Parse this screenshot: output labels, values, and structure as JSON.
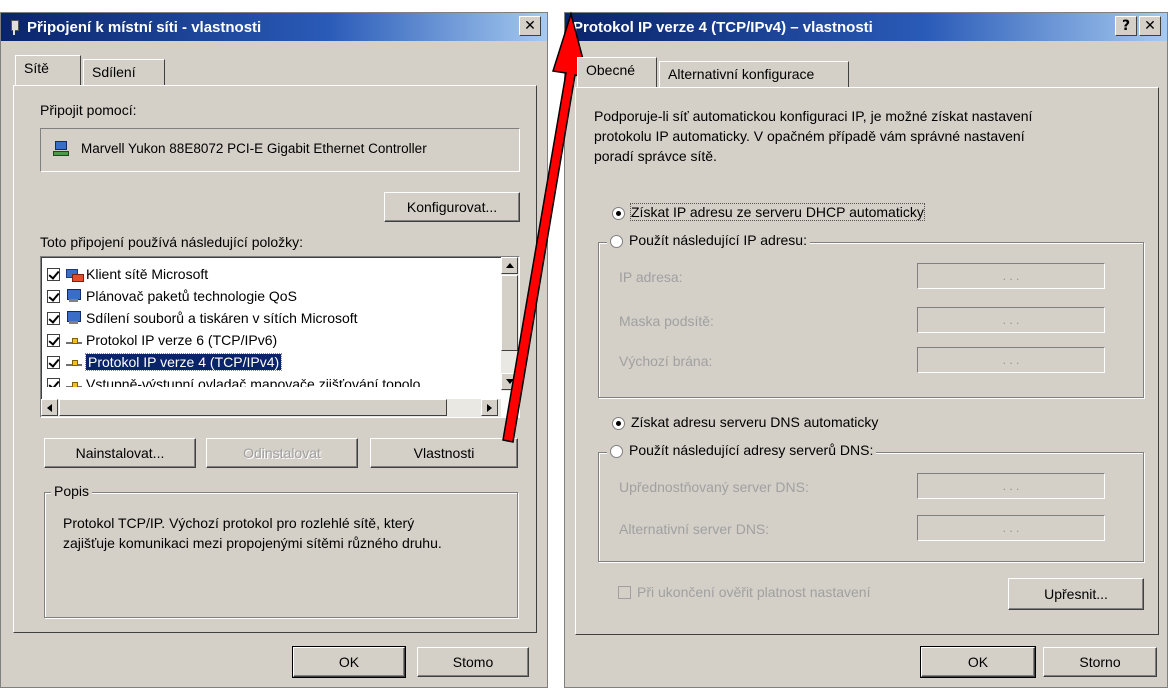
{
  "left_dialog": {
    "title": "Připojení k místní síti - vlastnosti",
    "close_glyph": "✕",
    "tabs": [
      {
        "label": "Sítě",
        "active": true
      },
      {
        "label": "Sdílení",
        "active": false
      }
    ],
    "connect_using_label": "Připojit pomocí:",
    "adapter_name": "Marvell Yukon 88E8072 PCI-E Gigabit Ethernet Controller",
    "configure_button": "Konfigurovat...",
    "items_label": "Toto připojení používá následující položky:",
    "items": [
      {
        "label": "Klient sítě Microsoft",
        "checked": true,
        "icon": "network-client-icon"
      },
      {
        "label": "Plánovač paketů technologie QoS",
        "checked": true,
        "icon": "computer-icon"
      },
      {
        "label": "Sdílení souborů a tiskáren v sítích Microsoft",
        "checked": true,
        "icon": "computer-icon"
      },
      {
        "label": "Protokol IP verze 6 (TCP/IPv6)",
        "checked": true,
        "icon": "protocol-icon"
      },
      {
        "label": "Protokol IP verze 4 (TCP/IPv4)",
        "checked": true,
        "icon": "protocol-icon",
        "selected": true
      },
      {
        "label": "Vstupně-výstupní ovladač mapovače zjišťování topolo",
        "checked": true,
        "icon": "protocol-icon"
      }
    ],
    "install_button": "Nainstalovat...",
    "uninstall_button": "Odinstalovat",
    "properties_button": "Vlastnosti",
    "description_group": "Popis",
    "description_text_1": "Protokol TCP/IP. Výchozí protokol pro rozlehlé sítě, který",
    "description_text_2": "zajišťuje komunikaci mezi propojenými sítěmi různého druhu.",
    "ok_button": "OK",
    "cancel_button": "Stomo"
  },
  "right_dialog": {
    "title": "Protokol IP verze 4 (TCP/IPv4) – vlastnosti",
    "help_glyph": "?",
    "close_glyph": "✕",
    "tabs": [
      {
        "label": "Obecné",
        "active": true
      },
      {
        "label": "Alternativní konfigurace",
        "active": false
      }
    ],
    "intro_line_1": "Podporuje-li síť automatickou konfiguraci IP, je možné získat nastavení",
    "intro_line_2": "protokolu IP automaticky. V opačném případě vám správné nastavení",
    "intro_line_3": "poradí správce sítě.",
    "radio_dhcp": "Získat IP adresu ze serveru DHCP automaticky",
    "radio_static_ip": "Použít následující IP adresu:",
    "ip_address_label": "IP adresa:",
    "subnet_mask_label": "Maska podsítě:",
    "gateway_label": "Výchozí brána:",
    "ip_dots": ".   .   .",
    "radio_dns_auto": "Získat adresu serveru DNS automaticky",
    "radio_dns_static": "Použít následující adresy serverů DNS:",
    "preferred_dns_label": "Upřednostňovaný server DNS:",
    "alternate_dns_label": "Alternativní server DNS:",
    "validate_checkbox": "Při ukončení ověřit platnost nastavení",
    "advanced_button": "Upřesnit...",
    "ok_button": "OK",
    "cancel_button": "Storno"
  },
  "colors": {
    "dialog_bg": "#d4d0c8",
    "title_start": "#0a246a",
    "selection": "#0a246a",
    "arrow": "#ff0000"
  }
}
